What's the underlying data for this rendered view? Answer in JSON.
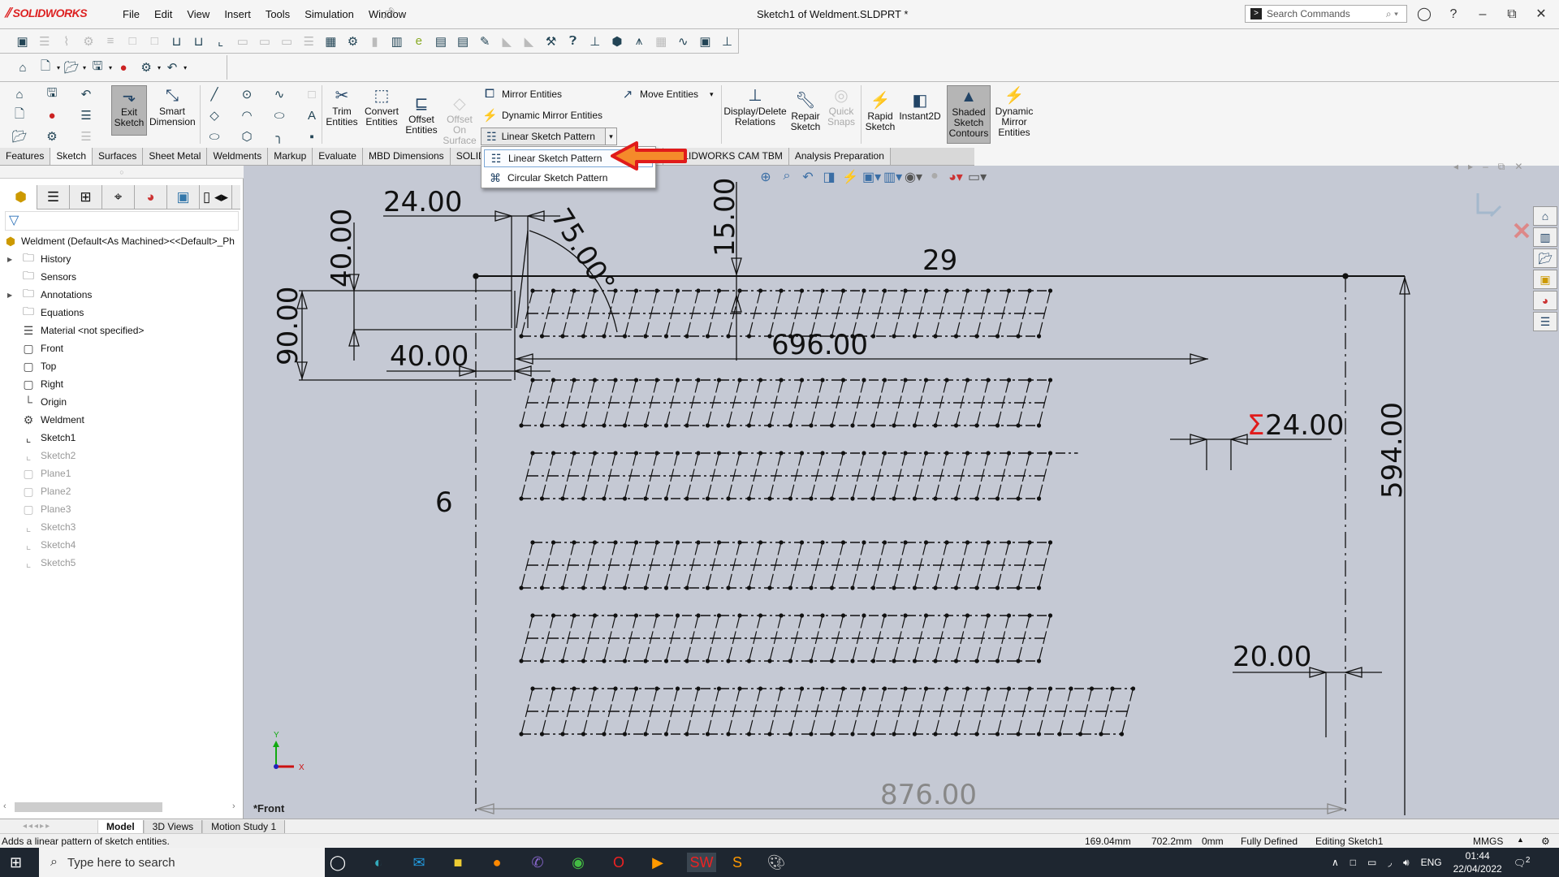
{
  "app": {
    "logo": "SOLIDWORKS",
    "menus": [
      "File",
      "Edit",
      "View",
      "Insert",
      "Tools",
      "Simulation",
      "Window"
    ],
    "document_title": "Sketch1 of Weldment.SLDPRT *",
    "search_placeholder": "Search Commands",
    "accent_color": "#d32f2f"
  },
  "command_manager": {
    "exit_sketch": "Exit\nSketch",
    "exit_sketch_l1": "Exit",
    "exit_sketch_l2": "Sketch",
    "smart_dim_l1": "Smart",
    "smart_dim_l2": "Dimension",
    "trim_l1": "Trim",
    "trim_l2": "Entities",
    "convert_l1": "Convert",
    "convert_l2": "Entities",
    "offset_l1": "Offset",
    "offset_l2": "Entities",
    "offset_surface_l1": "Offset",
    "offset_surface_l2": "On",
    "offset_surface_l3": "Surface",
    "mirror": "Mirror Entities",
    "dynamic_mirror": "Dynamic Mirror Entities",
    "linear_pattern": "Linear Sketch Pattern",
    "move": "Move Entities",
    "display_delete_l1": "Display/Delete",
    "display_delete_l2": "Relations",
    "repair_l1": "Repair",
    "repair_l2": "Sketch",
    "quick_snaps_l1": "Quick",
    "quick_snaps_l2": "Snaps",
    "rapid_l1": "Rapid",
    "rapid_l2": "Sketch",
    "instant2d": "Instant2D",
    "shaded_l1": "Shaded",
    "shaded_l2": "Sketch",
    "shaded_l3": "Contours",
    "dyn_mirror_l1": "Dynamic",
    "dyn_mirror_l2": "Mirror",
    "dyn_mirror_l3": "Entities"
  },
  "tabs": [
    "Features",
    "Sketch",
    "Surfaces",
    "Sheet Metal",
    "Weldments",
    "Markup",
    "Evaluate",
    "MBD Dimensions",
    "SOLID",
    "IDWORKS CAM",
    "SOLIDWORKS CAM TBM",
    "Analysis Preparation"
  ],
  "active_tab": "Sketch",
  "dropdown": {
    "items": [
      "Linear Sketch Pattern",
      "Circular Sketch Pattern"
    ],
    "highlighted": "Linear Sketch Pattern"
  },
  "feature_tree": {
    "root": "Weldment  (Default<As Machined><<Default>_Ph",
    "items": [
      {
        "label": "History",
        "icon": "history-folder",
        "expandable": true,
        "grayed": false
      },
      {
        "label": "Sensors",
        "icon": "sensors-folder",
        "expandable": false,
        "grayed": false
      },
      {
        "label": "Annotations",
        "icon": "annotations-folder",
        "expandable": true,
        "grayed": false
      },
      {
        "label": "Equations",
        "icon": "equations-folder",
        "expandable": false,
        "grayed": false
      },
      {
        "label": "Material <not specified>",
        "icon": "material",
        "expandable": false,
        "grayed": false
      },
      {
        "label": "Front",
        "icon": "plane",
        "expandable": false,
        "grayed": false
      },
      {
        "label": "Top",
        "icon": "plane",
        "expandable": false,
        "grayed": false
      },
      {
        "label": "Right",
        "icon": "plane",
        "expandable": false,
        "grayed": false
      },
      {
        "label": "Origin",
        "icon": "origin",
        "expandable": false,
        "grayed": false
      },
      {
        "label": "Weldment",
        "icon": "weldment",
        "expandable": false,
        "grayed": false
      },
      {
        "label": "Sketch1",
        "icon": "sketch",
        "expandable": false,
        "grayed": false
      },
      {
        "label": "Sketch2",
        "icon": "sketch",
        "expandable": false,
        "grayed": true
      },
      {
        "label": "Plane1",
        "icon": "plane",
        "expandable": false,
        "grayed": true
      },
      {
        "label": "Plane2",
        "icon": "plane",
        "expandable": false,
        "grayed": true
      },
      {
        "label": "Plane3",
        "icon": "plane",
        "expandable": false,
        "grayed": true
      },
      {
        "label": "Sketch3",
        "icon": "sketch",
        "expandable": false,
        "grayed": true
      },
      {
        "label": "Sketch4",
        "icon": "sketch",
        "expandable": false,
        "grayed": true
      },
      {
        "label": "Sketch5",
        "icon": "sketch",
        "expandable": false,
        "grayed": true
      }
    ]
  },
  "graphics": {
    "view_label": "*Front",
    "dimensions": {
      "d24": "24.00",
      "d75": "75.00°",
      "d15": "15.00",
      "d29": "29",
      "d40v": "40.00",
      "d90": "90.00",
      "d40h": "40.00",
      "d696": "696.00",
      "dsum24": "24.00",
      "dsum_symbol": "Σ",
      "d594": "594.00",
      "d6": "6",
      "d20": "20.00",
      "d876": "876.00"
    },
    "triad_x": "X",
    "triad_y": "Y"
  },
  "bottom_tabs": [
    "Model",
    "3D Views",
    "Motion Study 1"
  ],
  "active_bottom_tab": "Model",
  "status": {
    "message": "Adds a linear pattern of sketch entities.",
    "x": "169.04mm",
    "y": "702.2mm",
    "z": "0mm",
    "state": "Fully Defined",
    "editing": "Editing Sketch1",
    "units": "MMGS"
  },
  "taskbar": {
    "search_placeholder": "Type here to search",
    "language": "ENG",
    "time": "01:44",
    "date": "22/04/2022",
    "notifications": "2"
  }
}
